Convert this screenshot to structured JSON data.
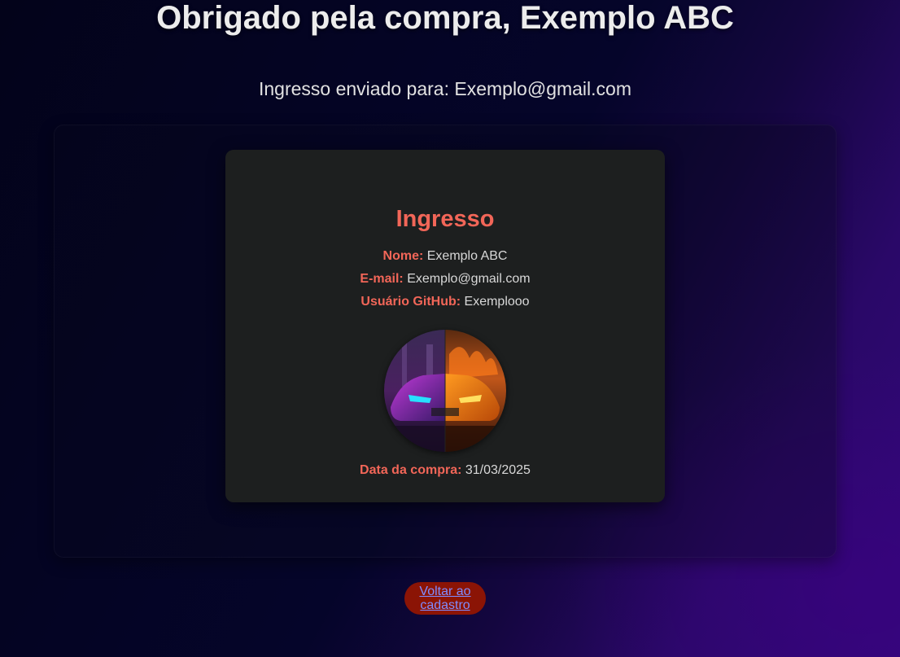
{
  "header": {
    "title": "Obrigado pela compra, Exemplo ABC",
    "sent_to": "Ingresso enviado para: Exemplo@gmail.com"
  },
  "ticket": {
    "title": "Ingresso",
    "name_label": "Nome:",
    "name_value": "Exemplo ABC",
    "email_label": "E-mail:",
    "email_value": "Exemplo@gmail.com",
    "github_label": "Usuário GitHub:",
    "github_value": "Exemplooo",
    "date_label": "Data da compra:",
    "date_value": "31/03/2025",
    "avatar_icon": "car-avatar-icon"
  },
  "actions": {
    "back_line1": "Voltar ao",
    "back_line2": "cadastro"
  },
  "colors": {
    "accent": "#f26658",
    "card_bg": "#1d1f1f",
    "button_bg": "#8b1405",
    "link": "#7f8cff"
  }
}
